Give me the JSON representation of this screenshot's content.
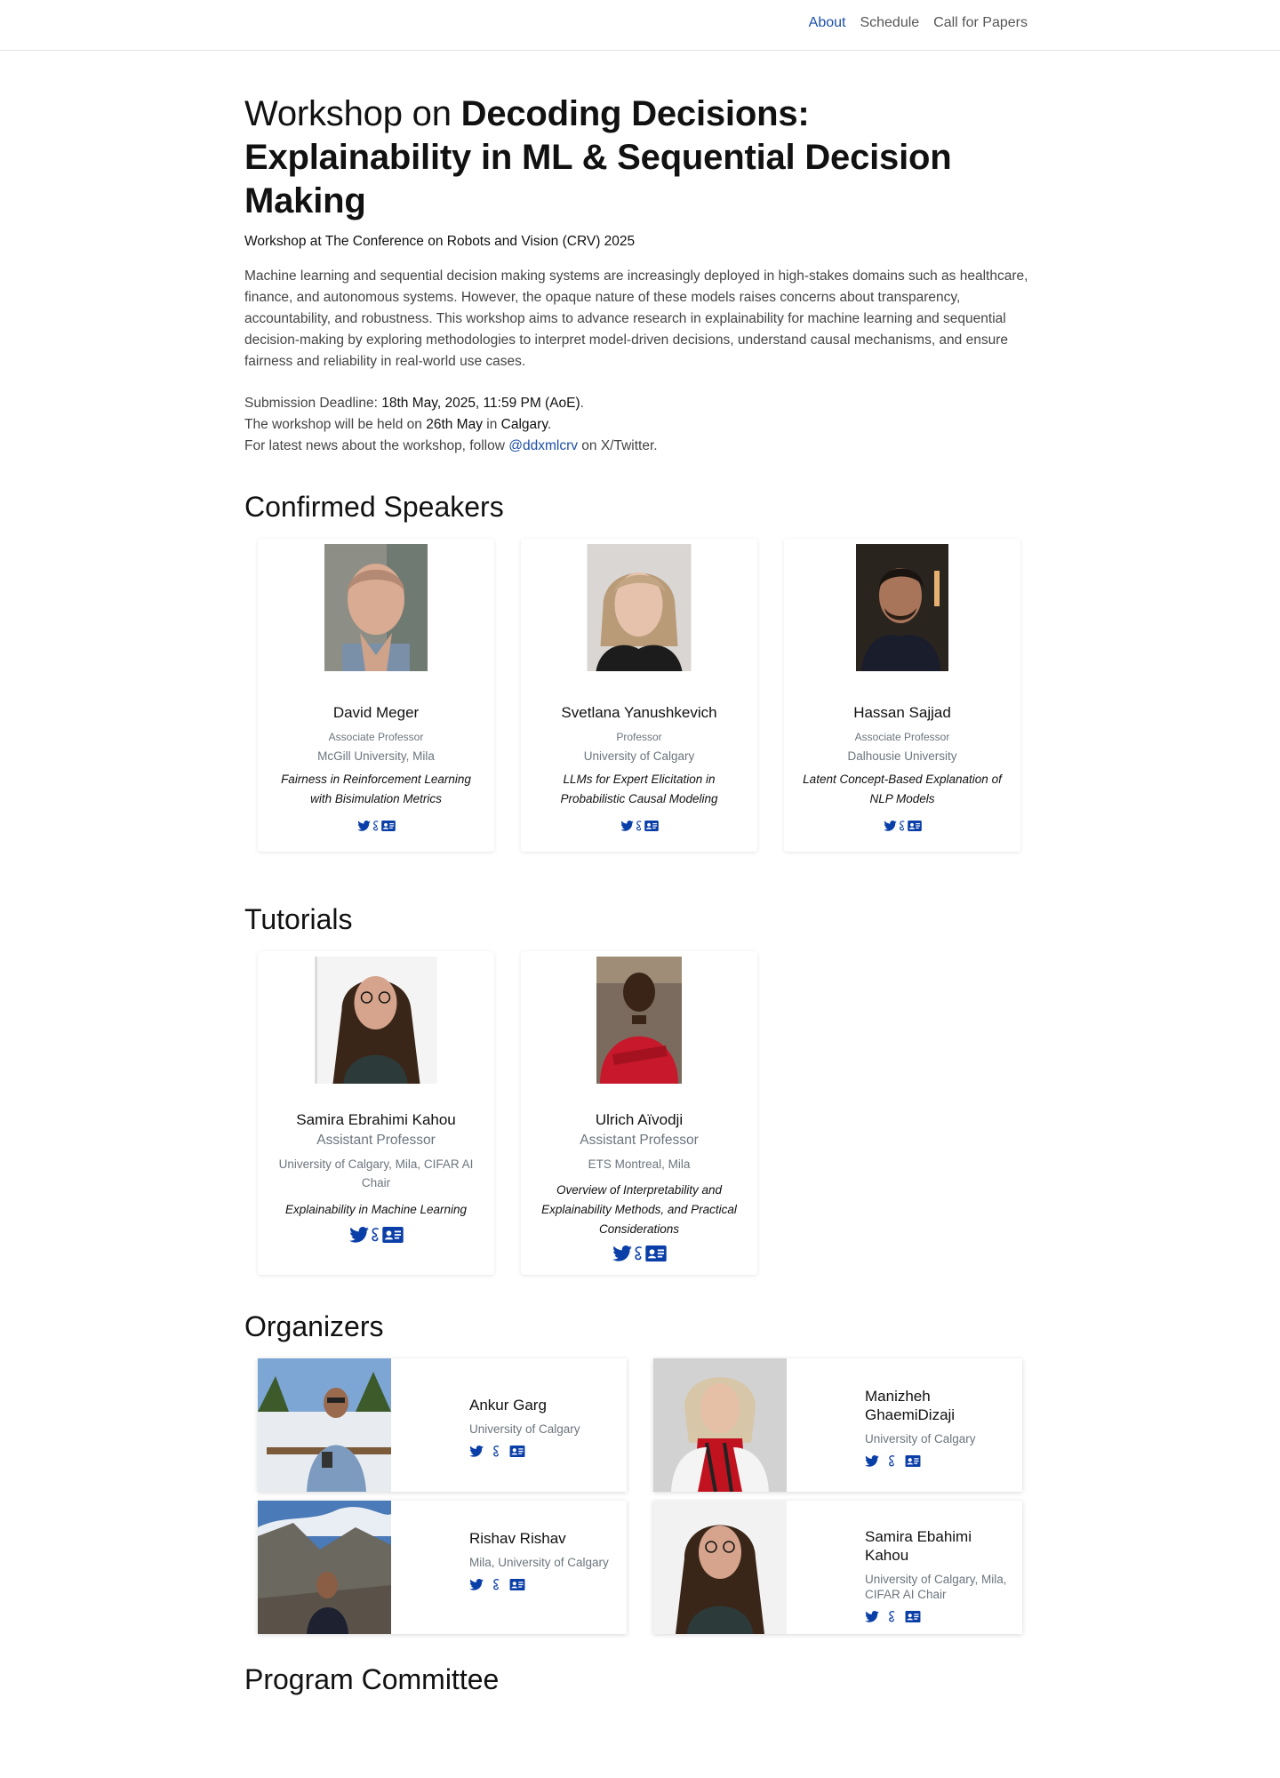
{
  "nav": {
    "items": [
      {
        "label": "About",
        "active": true
      },
      {
        "label": "Schedule",
        "active": false
      },
      {
        "label": "Call for Papers",
        "active": false
      }
    ]
  },
  "hero": {
    "title_prefix": "Workshop on ",
    "title_bold": "Decoding Decisions: Explainability in ML & Sequential Decision Making",
    "subtitle": "Workshop at The Conference on Robots and Vision (CRV) 2025",
    "description": "Machine learning and sequential decision making systems are increasingly deployed in high-stakes domains such as healthcare, finance, and autonomous systems. However, the opaque nature of these models raises concerns about transparency, accountability, and robustness. This workshop aims to advance research in explainability for machine learning and sequential decision-making by exploring methodologies to interpret model-driven decisions, understand causal mechanisms, and ensure fairness and reliability in real-world use cases.",
    "deadline_label": "Submission Deadline: ",
    "deadline_value": "18th May, 2025, 11:59 PM (AoE)",
    "deadline_end": ".",
    "held_prefix": "The workshop will be held on ",
    "held_date": "26th May",
    "held_mid": " in ",
    "held_place": "Calgary",
    "held_end": ".",
    "news_prefix": "For latest news about the workshop, follow ",
    "news_handle": "@ddxmlcrv",
    "news_suffix": " on X/Twitter."
  },
  "sections": {
    "speakers": "Confirmed Speakers",
    "tutorials": "Tutorials",
    "organizers": "Organizers",
    "committee": "Program Committee"
  },
  "speakers": [
    {
      "name": "David Meger",
      "role": "Associate Professor",
      "affiliation": "McGill University, Mila",
      "talk": "Fairness in Reinforcement Learning with Bisimulation Metrics"
    },
    {
      "name": "Svetlana Yanushkevich",
      "role": "Professor",
      "affiliation": "University of Calgary",
      "talk": "LLMs for Expert Elicitation in Probabilistic Causal Modeling"
    },
    {
      "name": "Hassan Sajjad",
      "role": "Associate Professor",
      "affiliation": "Dalhousie University",
      "talk": "Latent Concept-Based Explanation of NLP Models"
    }
  ],
  "tutorials": [
    {
      "name": "Samira Ebrahimi Kahou",
      "role": "Assistant Professor",
      "affiliation": "University of Calgary, Mila, CIFAR AI Chair",
      "talk": "Explainability in Machine Learning"
    },
    {
      "name": "Ulrich Aïvodji",
      "role": "Assistant Professor",
      "affiliation": "ETS Montreal, Mila",
      "talk": "Overview of Interpretability and Explainability Methods, and Practical Considerations"
    }
  ],
  "organizers": [
    {
      "name": "Ankur Garg",
      "affiliation": "University of Calgary"
    },
    {
      "name": "Manizheh GhaemiDizaji",
      "affiliation": "University of Calgary"
    },
    {
      "name": "Rishav Rishav",
      "affiliation": "Mila, University of Calgary"
    },
    {
      "name": "Samira Ebahimi Kahou",
      "affiliation": "University of Calgary, Mila, CIFAR AI Chair"
    }
  ],
  "icons": [
    "twitter-icon",
    "google-scholar-icon",
    "profile-card-icon"
  ],
  "colors": {
    "accent": "#1d4fa8",
    "icon": "#0b3fa8",
    "muted": "#6c757d"
  }
}
